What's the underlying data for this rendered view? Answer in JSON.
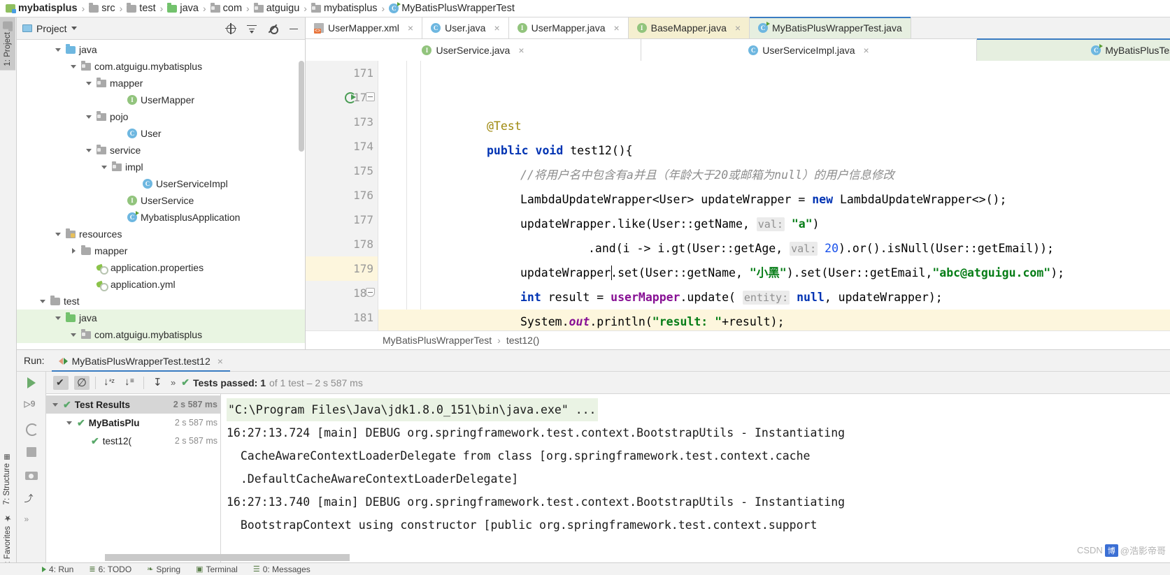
{
  "breadcrumb": [
    {
      "label": "mybatisplus",
      "icon": "module-icon",
      "bold": true
    },
    {
      "label": "src",
      "icon": "folder-gray-icon"
    },
    {
      "label": "test",
      "icon": "folder-gray-icon"
    },
    {
      "label": "java",
      "icon": "folder-green-icon"
    },
    {
      "label": "com",
      "icon": "package-icon"
    },
    {
      "label": "atguigu",
      "icon": "package-icon"
    },
    {
      "label": "mybatisplus",
      "icon": "package-icon"
    },
    {
      "label": "MyBatisPlusWrapperTest",
      "icon": "class-run-icon"
    }
  ],
  "rail": {
    "project": "1: Project",
    "structure": "7: Structure",
    "favorites": "2: Favorites"
  },
  "project_panel": {
    "title": "Project",
    "tree": [
      {
        "label": "java",
        "indent": 2,
        "arrow": "open",
        "icon": "folder-blue-icon"
      },
      {
        "label": "com.atguigu.mybatisplus",
        "indent": 3,
        "arrow": "open",
        "icon": "package-icon"
      },
      {
        "label": "mapper",
        "indent": 4,
        "arrow": "open",
        "icon": "package-icon"
      },
      {
        "label": "UserMapper",
        "indent": 6,
        "arrow": "none",
        "icon": "interface-icon"
      },
      {
        "label": "pojo",
        "indent": 4,
        "arrow": "open",
        "icon": "package-icon"
      },
      {
        "label": "User",
        "indent": 6,
        "arrow": "none",
        "icon": "class-icon"
      },
      {
        "label": "service",
        "indent": 4,
        "arrow": "open",
        "icon": "package-icon"
      },
      {
        "label": "impl",
        "indent": 5,
        "arrow": "open",
        "icon": "package-icon"
      },
      {
        "label": "UserServiceImpl",
        "indent": 7,
        "arrow": "none",
        "icon": "class-icon"
      },
      {
        "label": "UserService",
        "indent": 6,
        "arrow": "none",
        "icon": "interface-icon"
      },
      {
        "label": "MybatisplusApplication",
        "indent": 6,
        "arrow": "none",
        "icon": "class-run-icon"
      },
      {
        "label": "resources",
        "indent": 2,
        "arrow": "open",
        "icon": "resources-folder-icon"
      },
      {
        "label": "mapper",
        "indent": 3,
        "arrow": "closed",
        "icon": "folder-gray-icon"
      },
      {
        "label": "application.properties",
        "indent": 4,
        "arrow": "none",
        "icon": "properties-icon"
      },
      {
        "label": "application.yml",
        "indent": 4,
        "arrow": "none",
        "icon": "properties-icon"
      },
      {
        "label": "test",
        "indent": 1,
        "arrow": "open",
        "icon": "folder-gray-icon"
      },
      {
        "label": "java",
        "indent": 2,
        "arrow": "open",
        "icon": "folder-green-icon",
        "selected": true
      },
      {
        "label": "com.atguigu.mybatisplus",
        "indent": 3,
        "arrow": "open",
        "icon": "package-icon",
        "selected": true
      }
    ]
  },
  "editor_tabs_row1": [
    {
      "label": "UserMapper.xml",
      "icon": "xml-file-icon",
      "state": "white",
      "close": "×"
    },
    {
      "label": "User.java",
      "icon": "class-icon",
      "state": "white",
      "close": "×"
    },
    {
      "label": "UserMapper.java",
      "icon": "interface-icon",
      "state": "white",
      "close": "×"
    },
    {
      "label": "BaseMapper.java",
      "icon": "interface-icon",
      "state": "yellow",
      "close": "×"
    },
    {
      "label": "MyBatisPlusWrapperTest.java",
      "icon": "class-run-icon",
      "state": "active",
      "close": ""
    }
  ],
  "editor_tabs_row2": [
    {
      "label": "UserService.java",
      "icon": "interface-icon",
      "state": "white",
      "close": "×"
    },
    {
      "label": "UserServiceImpl.java",
      "icon": "class-icon",
      "state": "white",
      "close": "×"
    },
    {
      "label": "MyBatisPlusTest.java",
      "icon": "class-run-icon",
      "state": "active",
      "close": ""
    }
  ],
  "code": {
    "line_numbers": [
      "171",
      "172",
      "173",
      "174",
      "175",
      "176",
      "177",
      "178",
      "179",
      "180",
      "181"
    ],
    "current_line": "179",
    "lines": [
      "@Test",
      "public void test12(){",
      "//将用户名中包含有a并且（年龄大于20或邮箱为null）的用户信息修改",
      "LambdaUpdateWrapper<User> updateWrapper = new LambdaUpdateWrapper<>();",
      "updateWrapper.like(User::getName,  val: \"a\")",
      ".and(i -> i.gt(User::getAge,  val: 20).or().isNull(User::getEmail));",
      "updateWrapper.set(User::getName, \"小黑\").set(User::getEmail,\"abc@atguigu.com\");",
      "int result = userMapper.update( entity: null, updateWrapper);",
      "System.out.println(\"result: \"+result);",
      "}",
      ""
    ],
    "hints": {
      "val": "val:",
      "entity": "entity:"
    },
    "status_breadcrumb": [
      "MyBatisPlusWrapperTest",
      "test12()"
    ],
    "status_separator": "›"
  },
  "run_panel": {
    "run_label": "Run:",
    "run_tab": "MyBatisPlusWrapperTest.test12",
    "close_glyph": "×",
    "toolbar": {
      "chevrons": "»",
      "status_check": "✔",
      "status_bold": "Tests passed: 1",
      "status_dim": " of 1 test – 2 s 587 ms"
    },
    "tests_tree": [
      {
        "label": "Test Results",
        "time": "2 s 587 ms",
        "indent": 0,
        "arrow": "open",
        "selected": true,
        "bold": true
      },
      {
        "label": "MyBatisPlu",
        "time": "2 s 587 ms",
        "indent": 1,
        "arrow": "open",
        "bold": true
      },
      {
        "label": "test12(",
        "time": "2 s 587 ms",
        "indent": 2,
        "arrow": "none",
        "bold": false
      }
    ],
    "console_lines": [
      {
        "text": "\"C:\\Program Files\\Java\\jdk1.8.0_151\\bin\\java.exe\" ...",
        "highlight": true
      },
      {
        "text": "16:27:13.724 [main] DEBUG org.springframework.test.context.BootstrapUtils - Instantiating",
        "highlight": false
      },
      {
        "text": "  CacheAwareContextLoaderDelegate from class [org.springframework.test.context.cache",
        "highlight": false
      },
      {
        "text": "  .DefaultCacheAwareContextLoaderDelegate]",
        "highlight": false
      },
      {
        "text": "16:27:13.740 [main] DEBUG org.springframework.test.context.BootstrapUtils - Instantiating",
        "highlight": false
      },
      {
        "text": "  BootstrapContext using constructor [public org.springframework.test.context.support",
        "highlight": false
      }
    ]
  },
  "statusbar": [
    {
      "label": "4: Run",
      "icon": "play-icon"
    },
    {
      "label": "6: TODO",
      "icon": "list-icon"
    },
    {
      "label": "Spring",
      "icon": "leaf-icon"
    },
    {
      "label": "Terminal",
      "icon": "terminal-icon"
    },
    {
      "label": "0: Messages",
      "icon": "messages-icon"
    }
  ],
  "watermark": {
    "text": "CSDN",
    "badge": "博",
    "suffix": "@浩影帝哥"
  }
}
